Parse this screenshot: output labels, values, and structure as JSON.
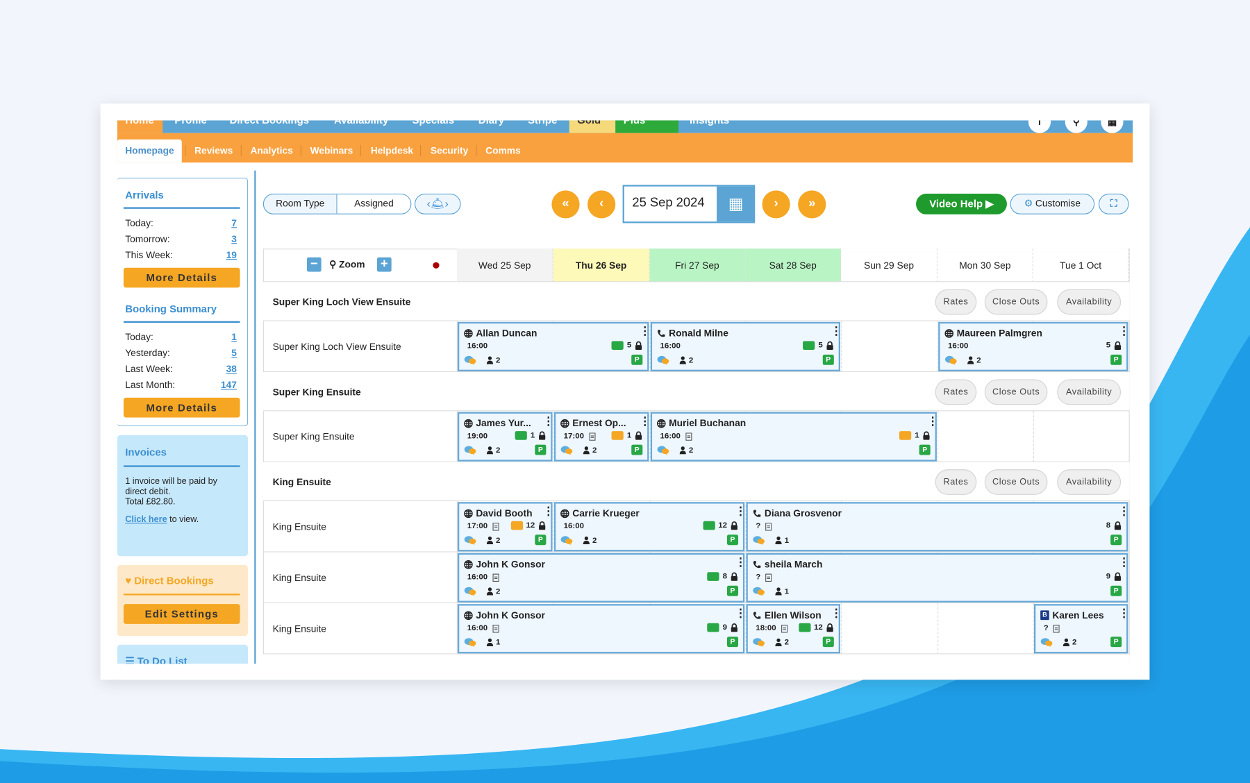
{
  "topnav": {
    "items": [
      "Home",
      "Profile",
      "Direct Bookings",
      "Availability",
      "Specials",
      "Diary",
      "Stripe",
      "Gold",
      "Plus",
      "Insights"
    ]
  },
  "subnav": {
    "tabs": [
      "Homepage",
      "Reviews",
      "Analytics",
      "Webinars",
      "Helpdesk",
      "Security",
      "Comms"
    ]
  },
  "sidebar": {
    "arrivals": {
      "title": "Arrivals",
      "rows": [
        {
          "label": "Today:",
          "value": "7"
        },
        {
          "label": "Tomorrow:",
          "value": "3"
        },
        {
          "label": "This Week:",
          "value": "19"
        }
      ],
      "button": "More Details"
    },
    "booking_summary": {
      "title": "Booking Summary",
      "rows": [
        {
          "label": "Today:",
          "value": "1"
        },
        {
          "label": "Yesterday:",
          "value": "5"
        },
        {
          "label": "Last Week:",
          "value": "38"
        },
        {
          "label": "Last Month:",
          "value": "147"
        }
      ],
      "button": "More Details"
    },
    "invoices": {
      "title": "Invoices",
      "line1": "1 invoice will be paid by",
      "line2": "direct debit.",
      "line3": "Total £82.80.",
      "link": "Click here",
      "after_link": " to view."
    },
    "direct_bookings": {
      "title": "Direct Bookings",
      "button": "Edit Settings"
    },
    "todo": {
      "title": "To Do List"
    }
  },
  "toolbar": {
    "view_room_type": "Room Type",
    "view_assigned": "Assigned",
    "date": "25 Sep 2024",
    "video_help": "Video Help",
    "customise": "Customise"
  },
  "grid": {
    "zoom_label": "Zoom",
    "days": [
      {
        "label": "Wed 25 Sep",
        "bg": "#f3f3f3"
      },
      {
        "label": "Thu 26 Sep",
        "bg": "#fdf9b8",
        "bold": true
      },
      {
        "label": "Fri 27 Sep",
        "bg": "#b9f5c4"
      },
      {
        "label": "Sat 28 Sep",
        "bg": "#b9f5c4"
      },
      {
        "label": "Sun 29 Sep",
        "bg": "#ffffff"
      },
      {
        "label": "Mon 30 Sep",
        "bg": "#ffffff"
      },
      {
        "label": "Tue 1 Oct",
        "bg": "#ffffff"
      }
    ],
    "section_buttons": [
      "Rates",
      "Close Outs",
      "Availability"
    ],
    "rows": [
      {
        "type": "section",
        "name": "Super King Loch View Ensuite"
      },
      {
        "type": "room",
        "name": "Super King Loch View Ensuite",
        "bookings": [
          {
            "start": 0,
            "end": 1,
            "source": "globe",
            "name": "Allan Duncan",
            "time": "16:00",
            "doc": false,
            "card": "green",
            "num": "5",
            "people": "2"
          },
          {
            "start": 2,
            "end": 3,
            "source": "phone",
            "name": "Ronald Milne",
            "time": "16:00",
            "doc": false,
            "card": "green",
            "num": "5",
            "people": "2"
          },
          {
            "start": 5,
            "end": 6,
            "source": "globe",
            "name": "Maureen Palmgren",
            "time": "16:00",
            "doc": false,
            "card": "",
            "num": "5",
            "people": "2"
          }
        ]
      },
      {
        "type": "section",
        "name": "Super King Ensuite"
      },
      {
        "type": "room",
        "name": "Super King Ensuite",
        "bookings": [
          {
            "start": 0,
            "end": 0,
            "source": "globe",
            "name": "James Yur...",
            "time": "19:00",
            "doc": false,
            "card": "green",
            "num": "1",
            "people": "2"
          },
          {
            "start": 1,
            "end": 1,
            "source": "globe",
            "name": "Ernest Op...",
            "time": "17:00",
            "doc": true,
            "card": "orange",
            "num": "1",
            "people": "2"
          },
          {
            "start": 2,
            "end": 4,
            "source": "globe",
            "name": "Muriel Buchanan",
            "time": "16:00",
            "doc": true,
            "card": "orange",
            "num": "1",
            "people": "2"
          }
        ]
      },
      {
        "type": "section",
        "name": "King Ensuite"
      },
      {
        "type": "room",
        "name": "King Ensuite",
        "bookings": [
          {
            "start": 0,
            "end": 0,
            "source": "globe",
            "name": "David Booth",
            "time": "17:00",
            "doc": true,
            "card": "orange",
            "num": "12",
            "people": "2"
          },
          {
            "start": 1,
            "end": 2,
            "source": "globe",
            "name": "Carrie Krueger",
            "time": "16:00",
            "doc": false,
            "card": "green",
            "num": "12",
            "people": "2"
          },
          {
            "start": 3,
            "end": 6,
            "source": "phone",
            "name": "Diana Grosvenor",
            "time": "?",
            "doc": true,
            "card": "",
            "num": "8",
            "people": "1"
          }
        ]
      },
      {
        "type": "room",
        "name": "King Ensuite",
        "bookings": [
          {
            "start": 0,
            "end": 2,
            "source": "globe",
            "name": "John K Gonsor",
            "time": "16:00",
            "doc": true,
            "card": "green",
            "num": "8",
            "people": "2"
          },
          {
            "start": 3,
            "end": 6,
            "source": "phone",
            "name": "sheila March",
            "time": "?",
            "doc": true,
            "card": "",
            "num": "9",
            "people": "1"
          }
        ]
      },
      {
        "type": "room",
        "name": "King Ensuite",
        "bookings": [
          {
            "start": 0,
            "end": 2,
            "source": "globe",
            "name": "John K Gonsor",
            "time": "16:00",
            "doc": true,
            "card": "green",
            "num": "9",
            "people": "1"
          },
          {
            "start": 3,
            "end": 3,
            "source": "phone",
            "name": "Ellen Wilson",
            "time": "18:00",
            "doc": true,
            "card": "green",
            "num": "12",
            "people": "2"
          },
          {
            "start": 6,
            "end": 6,
            "source": "booking",
            "name": "Karen Lees",
            "time": "?",
            "doc": true,
            "card": "",
            "num": "",
            "people": "2"
          }
        ]
      }
    ]
  },
  "colors": {
    "orange": "#f9a13f",
    "blue": "#5ba4d4",
    "green": "#28a745",
    "gold": "#f5d97a"
  }
}
